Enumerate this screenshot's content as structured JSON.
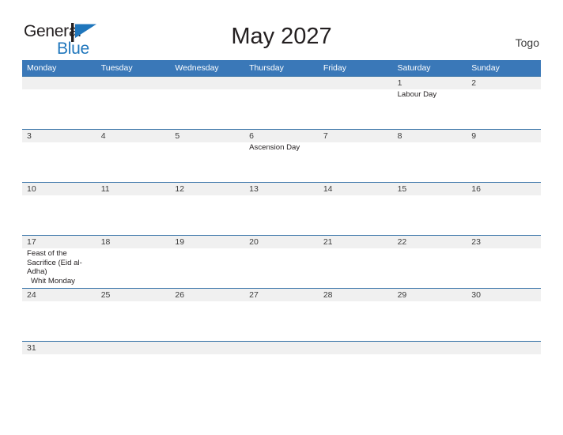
{
  "brand": {
    "name_part1": "General",
    "name_part2": "Blue",
    "mark_icon": "blue-flag-triangle-icon",
    "accent_color": "#1f76bc"
  },
  "header": {
    "title": "May 2027",
    "region": "Togo"
  },
  "calendar": {
    "header_background": "#3a78b8",
    "row_border_color": "#2e6da4",
    "daynum_band_color": "#f0f0f0",
    "weekdays": [
      "Monday",
      "Tuesday",
      "Wednesday",
      "Thursday",
      "Friday",
      "Saturday",
      "Sunday"
    ],
    "weeks": [
      {
        "days": [
          {
            "num": "",
            "events": []
          },
          {
            "num": "",
            "events": []
          },
          {
            "num": "",
            "events": []
          },
          {
            "num": "",
            "events": []
          },
          {
            "num": "",
            "events": []
          },
          {
            "num": "1",
            "events": [
              {
                "text": "Labour Day",
                "indent": false
              }
            ]
          },
          {
            "num": "2",
            "events": []
          }
        ]
      },
      {
        "days": [
          {
            "num": "3",
            "events": []
          },
          {
            "num": "4",
            "events": []
          },
          {
            "num": "5",
            "events": []
          },
          {
            "num": "6",
            "events": [
              {
                "text": "Ascension Day",
                "indent": false
              }
            ]
          },
          {
            "num": "7",
            "events": []
          },
          {
            "num": "8",
            "events": []
          },
          {
            "num": "9",
            "events": []
          }
        ]
      },
      {
        "days": [
          {
            "num": "10",
            "events": []
          },
          {
            "num": "11",
            "events": []
          },
          {
            "num": "12",
            "events": []
          },
          {
            "num": "13",
            "events": []
          },
          {
            "num": "14",
            "events": []
          },
          {
            "num": "15",
            "events": []
          },
          {
            "num": "16",
            "events": []
          }
        ]
      },
      {
        "days": [
          {
            "num": "17",
            "events": [
              {
                "text": "Feast of the Sacrifice (Eid al-Adha)",
                "indent": false
              },
              {
                "text": "Whit Monday",
                "indent": true
              }
            ]
          },
          {
            "num": "18",
            "events": []
          },
          {
            "num": "19",
            "events": []
          },
          {
            "num": "20",
            "events": []
          },
          {
            "num": "21",
            "events": []
          },
          {
            "num": "22",
            "events": []
          },
          {
            "num": "23",
            "events": []
          }
        ]
      },
      {
        "days": [
          {
            "num": "24",
            "events": []
          },
          {
            "num": "25",
            "events": []
          },
          {
            "num": "26",
            "events": []
          },
          {
            "num": "27",
            "events": []
          },
          {
            "num": "28",
            "events": []
          },
          {
            "num": "29",
            "events": []
          },
          {
            "num": "30",
            "events": []
          }
        ]
      },
      {
        "last": true,
        "days": [
          {
            "num": "31",
            "events": []
          },
          {
            "num": "",
            "events": []
          },
          {
            "num": "",
            "events": []
          },
          {
            "num": "",
            "events": []
          },
          {
            "num": "",
            "events": []
          },
          {
            "num": "",
            "events": []
          },
          {
            "num": "",
            "events": []
          }
        ]
      }
    ]
  }
}
